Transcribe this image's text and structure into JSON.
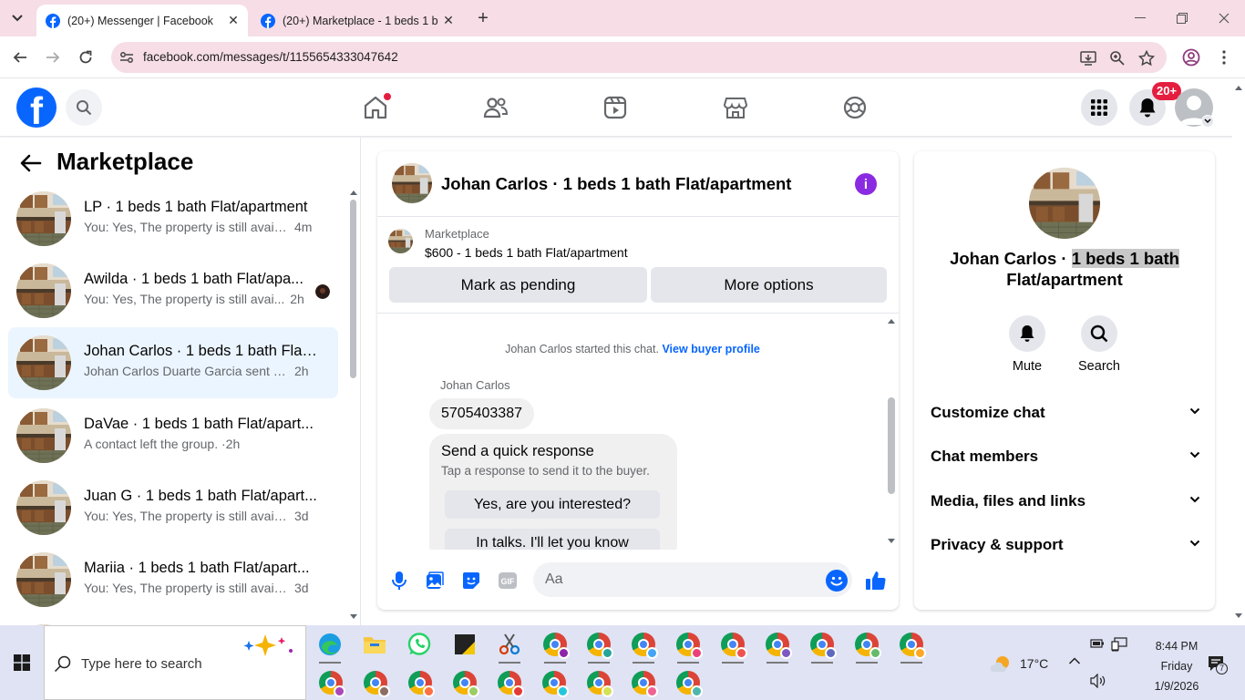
{
  "browser": {
    "tabs": [
      {
        "title": "(20+) Messenger | Facebook",
        "active": true
      },
      {
        "title": "(20+) Marketplace - 1 beds 1 b",
        "active": false
      }
    ],
    "url": "facebook.com/messages/t/1155654333047642"
  },
  "fb_header": {
    "logo_letter": "f",
    "notification_badge": "20+"
  },
  "left_panel": {
    "title": "Marketplace",
    "conversations": [
      {
        "name": "LP · 1 beds 1 bath Flat/apartment",
        "snippet": "You: Yes, The property is still availa...",
        "time": "4m"
      },
      {
        "name": "Awilda · 1 beds 1 bath Flat/apa...",
        "snippet": "You: Yes, The property is still avai...",
        "time": "2h"
      },
      {
        "name": "Johan Carlos · 1 beds 1 bath Flat/...",
        "snippet": "Johan Carlos Duarte Garcia sent yo...",
        "time": "2h"
      },
      {
        "name": "DaVae · 1 beds 1 bath Flat/apart...",
        "snippet": "A contact left the group. ·",
        "time": "2h"
      },
      {
        "name": "Juan G · 1 beds 1 bath Flat/apart...",
        "snippet": "You: Yes, The property is still availab...",
        "time": "3d"
      },
      {
        "name": "Mariia · 1 beds 1 bath Flat/apart...",
        "snippet": "You: Yes, The property is still availab...",
        "time": "3d"
      }
    ]
  },
  "chat": {
    "title": "Johan Carlos · 1 beds 1 bath Flat/apartment",
    "listing_source": "Marketplace",
    "listing_price": "$600 - 1 beds 1 bath Flat/apartment",
    "mark_pending_label": "Mark as pending",
    "more_options_label": "More options",
    "system_message": "Johan Carlos started this chat.",
    "view_buyer_label": "View buyer profile",
    "sender": "Johan Carlos",
    "message_text": "5705403387",
    "quick_title": "Send a quick response",
    "quick_subtitle": "Tap a response to send it to the buyer.",
    "quick_options": [
      "Yes, are you interested?",
      "In talks. I'll let you know"
    ],
    "composer_placeholder": "Aa"
  },
  "info_panel": {
    "name_plain": "Johan Carlos · ",
    "name_highlight": "1 beds 1 bath",
    "name_rest": "Flat/apartment",
    "mute_label": "Mute",
    "search_label": "Search",
    "sections": [
      "Customize chat",
      "Chat members",
      "Media, files and links",
      "Privacy & support"
    ]
  },
  "taskbar": {
    "search_placeholder": "Type here to search",
    "temperature": "17°C",
    "time": "8:44 PM",
    "day": "Friday",
    "date": "1/9/2026",
    "notification_count": "7"
  },
  "colors": {
    "fb_blue": "#0866ff",
    "badge_red": "#e41e3f",
    "info_purple": "#8a2be2",
    "tab_strip": "#f6dde6",
    "active_convo": "#ebf5ff"
  }
}
